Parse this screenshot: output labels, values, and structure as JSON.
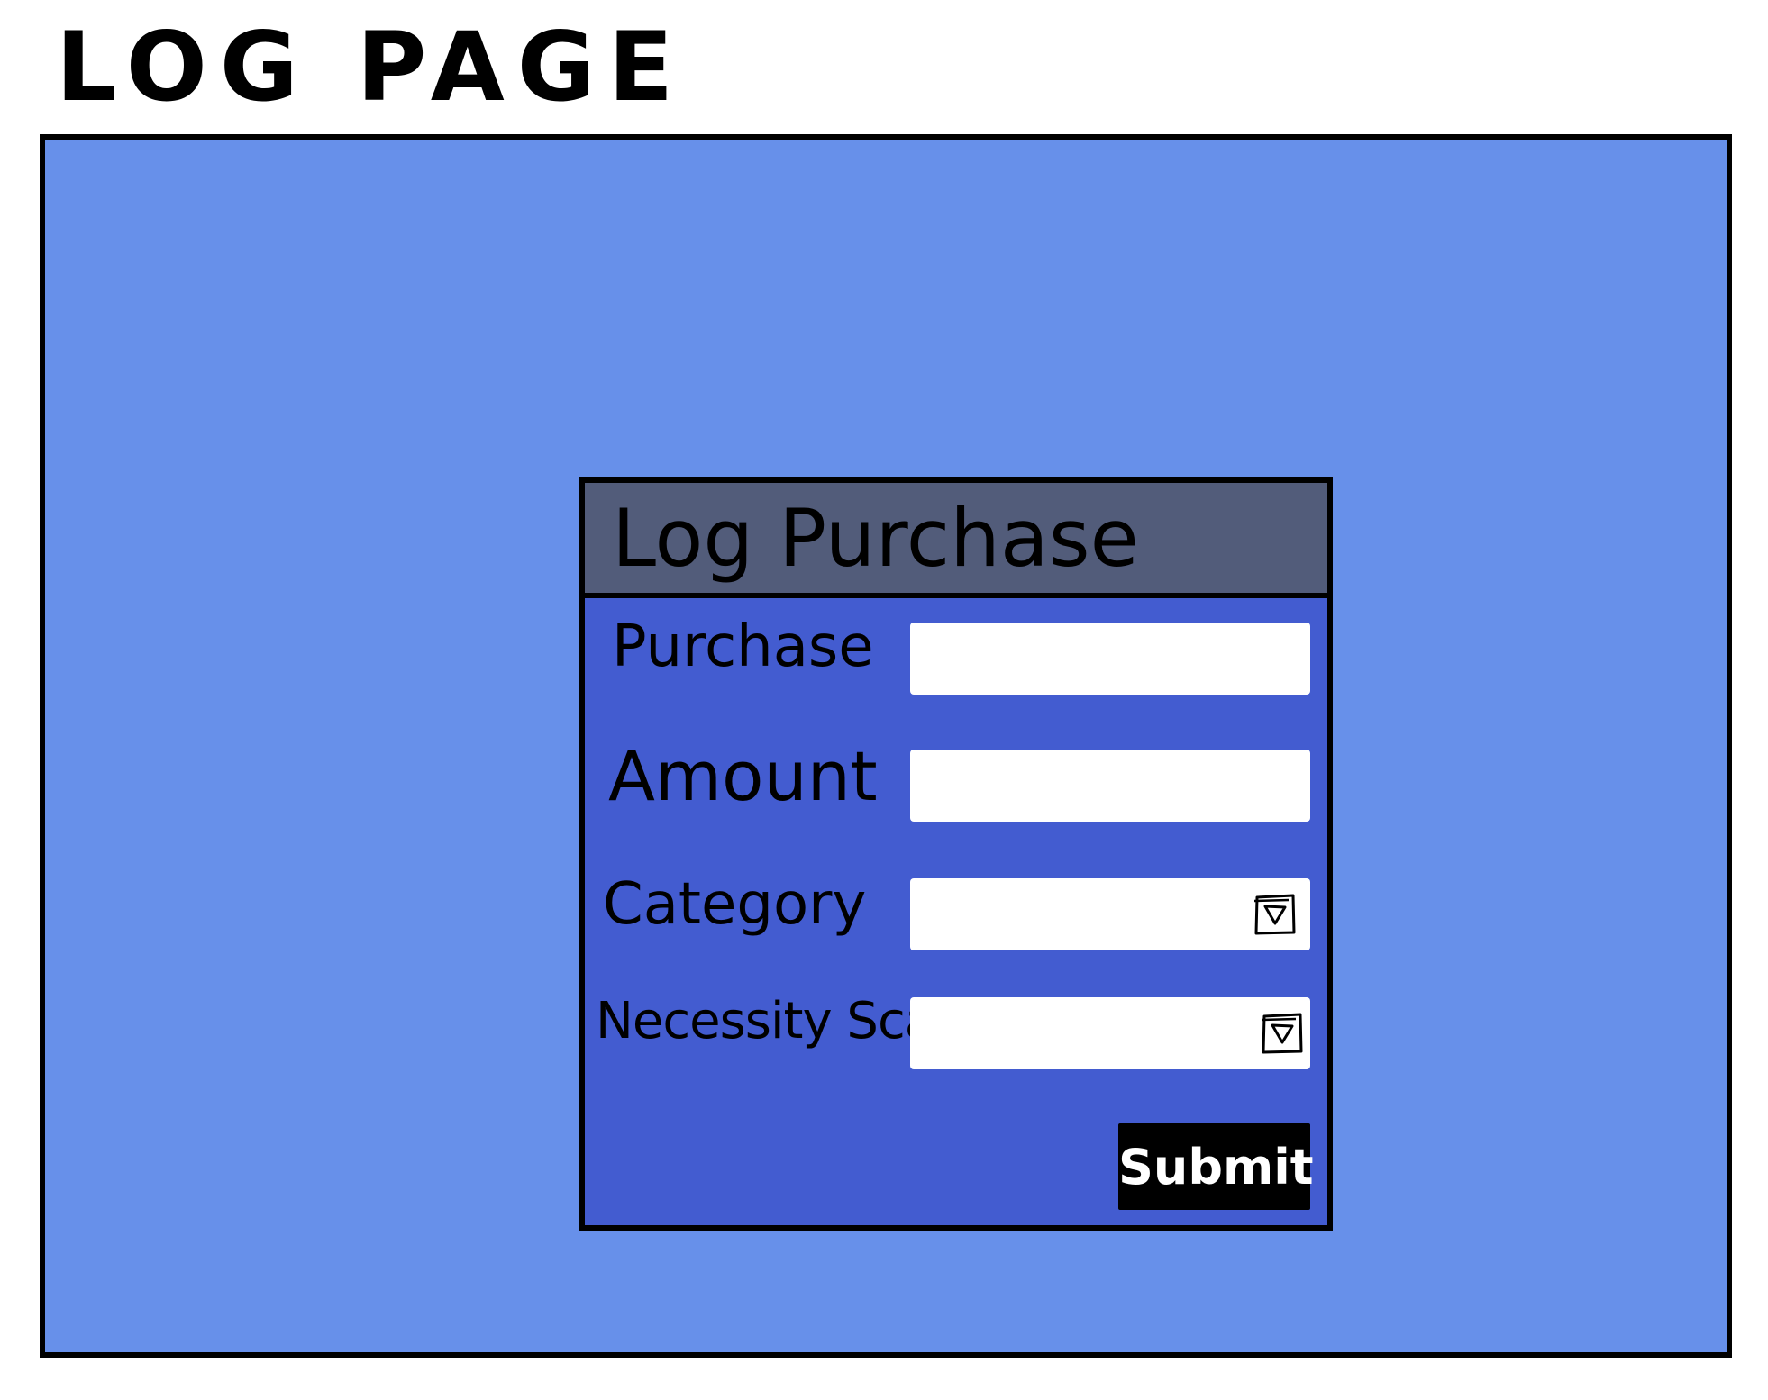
{
  "page": {
    "heading": "LOG PAGE"
  },
  "dialog": {
    "title": "Log Purchase",
    "fields": {
      "purchase": {
        "label": "Purchase",
        "value": "",
        "placeholder": ""
      },
      "amount": {
        "label": "Amount",
        "value": "",
        "placeholder": ""
      },
      "category": {
        "label": "Category",
        "selected": "",
        "icon": "chevron-down-icon"
      },
      "necessity_scale": {
        "label": "Necessity Scale",
        "selected": "",
        "icon": "chevron-down-icon"
      }
    },
    "submit_label": "Submit"
  },
  "colors": {
    "window_background": "#6790ea",
    "dialog_body": "#435cd0",
    "dialog_header": "#525c7a",
    "field_background": "#ffffff",
    "button_background": "#000000",
    "button_text": "#ffffff",
    "outline": "#000000"
  }
}
